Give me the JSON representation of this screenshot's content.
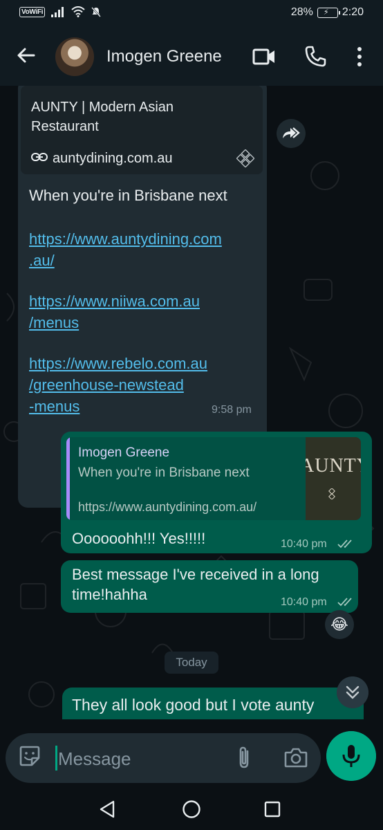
{
  "status_bar": {
    "network_badge": "VoWiFi",
    "battery_percent": "28%",
    "time": "2:20"
  },
  "header": {
    "contact_name": "Imogen Greene",
    "icons": [
      "back-arrow-icon",
      "avatar",
      "video-call-icon",
      "phone-call-icon",
      "more-vert-icon"
    ]
  },
  "chat": {
    "incoming": {
      "preview_title": "AUNTY | Modern Asian Restaurant",
      "preview_domain": "auntydining.com.au",
      "text": "When you're in Brisbane next",
      "links": [
        [
          "https://www.auntydining.com",
          ".au/"
        ],
        [
          "https://www.niiwa.com.au",
          "/menus"
        ],
        [
          "https://www.rebelo.com.au",
          "/greenhouse-newstead",
          "-menus"
        ]
      ],
      "time": "9:58 pm"
    },
    "outgoing_reply": {
      "quote_name": "Imogen Greene",
      "quote_text": "When you're in Brisbane next",
      "quote_url": "https://www.auntydining.com.au/",
      "quote_thumb_text": "AUNTY",
      "text": "Oooooohh!!! Yes!!!!!",
      "time": "10:40 pm"
    },
    "outgoing_2": {
      "lines": [
        "Best message I've received in a long",
        "time!hahha"
      ],
      "time": "10:40 pm"
    },
    "reaction_emoji": "😂",
    "date_divider": "Today",
    "outgoing_last": {
      "text": "They all look good but I vote aunty dining or greenhouse first!!"
    }
  },
  "composer": {
    "placeholder": "Message"
  },
  "colors": {
    "header_bg": "#111b21",
    "chat_bg": "#0b1014",
    "incoming_bubble": "#202c33",
    "outgoing_bubble": "#005c4b",
    "accent": "#00a884",
    "link": "#53bdeb"
  }
}
